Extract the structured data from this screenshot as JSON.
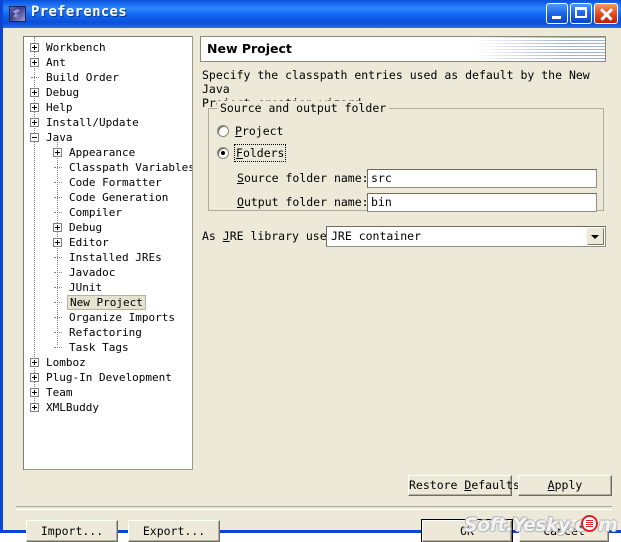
{
  "window": {
    "title": "Preferences",
    "icon": "eclipse-icon",
    "controls": {
      "minimize": "minimize-icon",
      "maximize": "maximize-icon",
      "close": "close-icon"
    }
  },
  "tree": [
    {
      "label": "Workbench",
      "depth": 0,
      "expander": "plus",
      "selected": false
    },
    {
      "label": "Ant",
      "depth": 0,
      "expander": "plus",
      "selected": false
    },
    {
      "label": "Build Order",
      "depth": 0,
      "expander": "none",
      "selected": false
    },
    {
      "label": "Debug",
      "depth": 0,
      "expander": "plus",
      "selected": false
    },
    {
      "label": "Help",
      "depth": 0,
      "expander": "plus",
      "selected": false
    },
    {
      "label": "Install/Update",
      "depth": 0,
      "expander": "plus",
      "selected": false
    },
    {
      "label": "Java",
      "depth": 0,
      "expander": "minus",
      "selected": false
    },
    {
      "label": "Appearance",
      "depth": 1,
      "expander": "plus",
      "selected": false
    },
    {
      "label": "Classpath Variables",
      "depth": 1,
      "expander": "none",
      "selected": false
    },
    {
      "label": "Code Formatter",
      "depth": 1,
      "expander": "none",
      "selected": false
    },
    {
      "label": "Code Generation",
      "depth": 1,
      "expander": "none",
      "selected": false
    },
    {
      "label": "Compiler",
      "depth": 1,
      "expander": "none",
      "selected": false
    },
    {
      "label": "Debug",
      "depth": 1,
      "expander": "plus",
      "selected": false
    },
    {
      "label": "Editor",
      "depth": 1,
      "expander": "plus",
      "selected": false
    },
    {
      "label": "Installed JREs",
      "depth": 1,
      "expander": "none",
      "selected": false
    },
    {
      "label": "Javadoc",
      "depth": 1,
      "expander": "none",
      "selected": false
    },
    {
      "label": "JUnit",
      "depth": 1,
      "expander": "none",
      "selected": false
    },
    {
      "label": "New Project",
      "depth": 1,
      "expander": "none",
      "selected": true
    },
    {
      "label": "Organize Imports",
      "depth": 1,
      "expander": "none",
      "selected": false
    },
    {
      "label": "Refactoring",
      "depth": 1,
      "expander": "none",
      "selected": false
    },
    {
      "label": "Task Tags",
      "depth": 1,
      "expander": "none",
      "selected": false
    },
    {
      "label": "Lomboz",
      "depth": 0,
      "expander": "plus",
      "selected": false
    },
    {
      "label": "Plug-In Development",
      "depth": 0,
      "expander": "plus",
      "selected": false
    },
    {
      "label": "Team",
      "depth": 0,
      "expander": "plus",
      "selected": false
    },
    {
      "label": "XMLBuddy",
      "depth": 0,
      "expander": "plus",
      "selected": false
    }
  ],
  "page": {
    "header_title": "New Project",
    "description": "Specify the classpath entries used as default by the New Java\nProject creation wizard:",
    "group": {
      "legend": "Source and output folder",
      "radios": [
        {
          "label": "Project",
          "mnemonic": "P",
          "selected": false,
          "focused": false
        },
        {
          "label": "Folders",
          "mnemonic": "F",
          "selected": true,
          "focused": true
        }
      ],
      "fields": [
        {
          "label": "Source folder name:",
          "mnemonic": "S",
          "value": "src"
        },
        {
          "label": "Output folder name:",
          "mnemonic": "O",
          "value": "bin"
        }
      ]
    },
    "jre": {
      "label": "As JRE library use:",
      "mnemonic": "J",
      "selected": "JRE container",
      "options": [
        "JRE container"
      ]
    }
  },
  "buttons": {
    "restore_defaults": "Restore Defaults",
    "apply": "Apply",
    "import": "Import...",
    "export": "Export...",
    "ok": "OK",
    "cancel": "Cancel"
  },
  "watermark": {
    "head": "Soft.Yesky.c",
    "tail": "m"
  },
  "colors": {
    "titlebar_blue": "#0a52d8",
    "dialog_face": "#ece9d8",
    "field_white": "#ffffff",
    "close_red": "#e8502a",
    "selection": "#e4e2d0",
    "watermark_red": "#e02020"
  }
}
